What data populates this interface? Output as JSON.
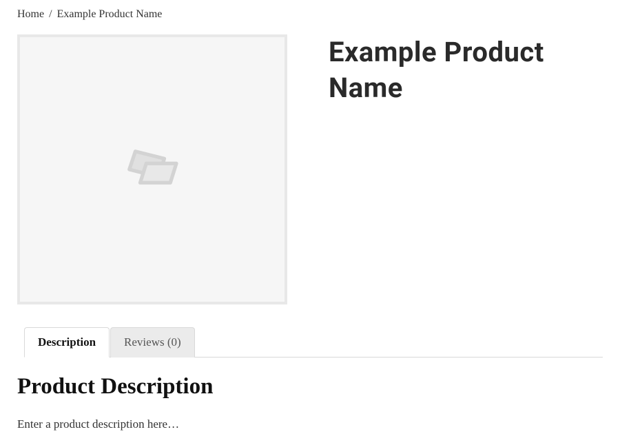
{
  "breadcrumb": {
    "home_label": "Home",
    "separator": "/",
    "current": "Example Product Name"
  },
  "product": {
    "title": "Example Product Name"
  },
  "tabs": {
    "description_label": "Description",
    "reviews_label": "Reviews (0)"
  },
  "content": {
    "section_heading": "Product Description",
    "description_text": "Enter a product description here…"
  }
}
